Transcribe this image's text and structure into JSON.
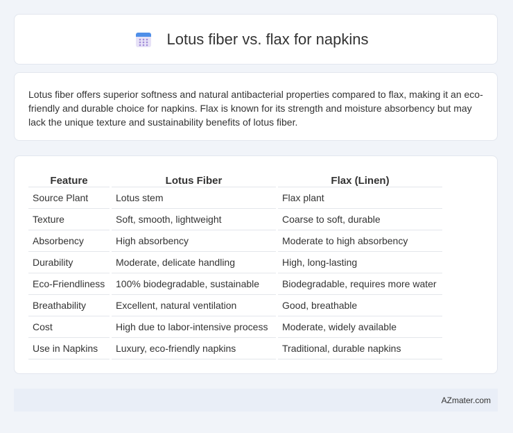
{
  "header": {
    "title": "Lotus fiber vs. flax for napkins",
    "icon": "calendar-icon"
  },
  "intro": {
    "text": "Lotus fiber offers superior softness and natural antibacterial properties compared to flax, making it an eco-friendly and durable choice for napkins. Flax is known for its strength and moisture absorbency but may lack the unique texture and sustainability benefits of lotus fiber."
  },
  "table": {
    "headers": [
      "Feature",
      "Lotus Fiber",
      "Flax (Linen)"
    ],
    "rows": [
      [
        "Source Plant",
        "Lotus stem",
        "Flax plant"
      ],
      [
        "Texture",
        "Soft, smooth, lightweight",
        "Coarse to soft, durable"
      ],
      [
        "Absorbency",
        "High absorbency",
        "Moderate to high absorbency"
      ],
      [
        "Durability",
        "Moderate, delicate handling",
        "High, long-lasting"
      ],
      [
        "Eco-Friendliness",
        "100% biodegradable, sustainable",
        "Biodegradable, requires more water"
      ],
      [
        "Breathability",
        "Excellent, natural ventilation",
        "Good, breathable"
      ],
      [
        "Cost",
        "High due to labor-intensive process",
        "Moderate, widely available"
      ],
      [
        "Use in Napkins",
        "Luxury, eco-friendly napkins",
        "Traditional, durable napkins"
      ]
    ]
  },
  "footer": {
    "brand": "AZmater.com"
  }
}
